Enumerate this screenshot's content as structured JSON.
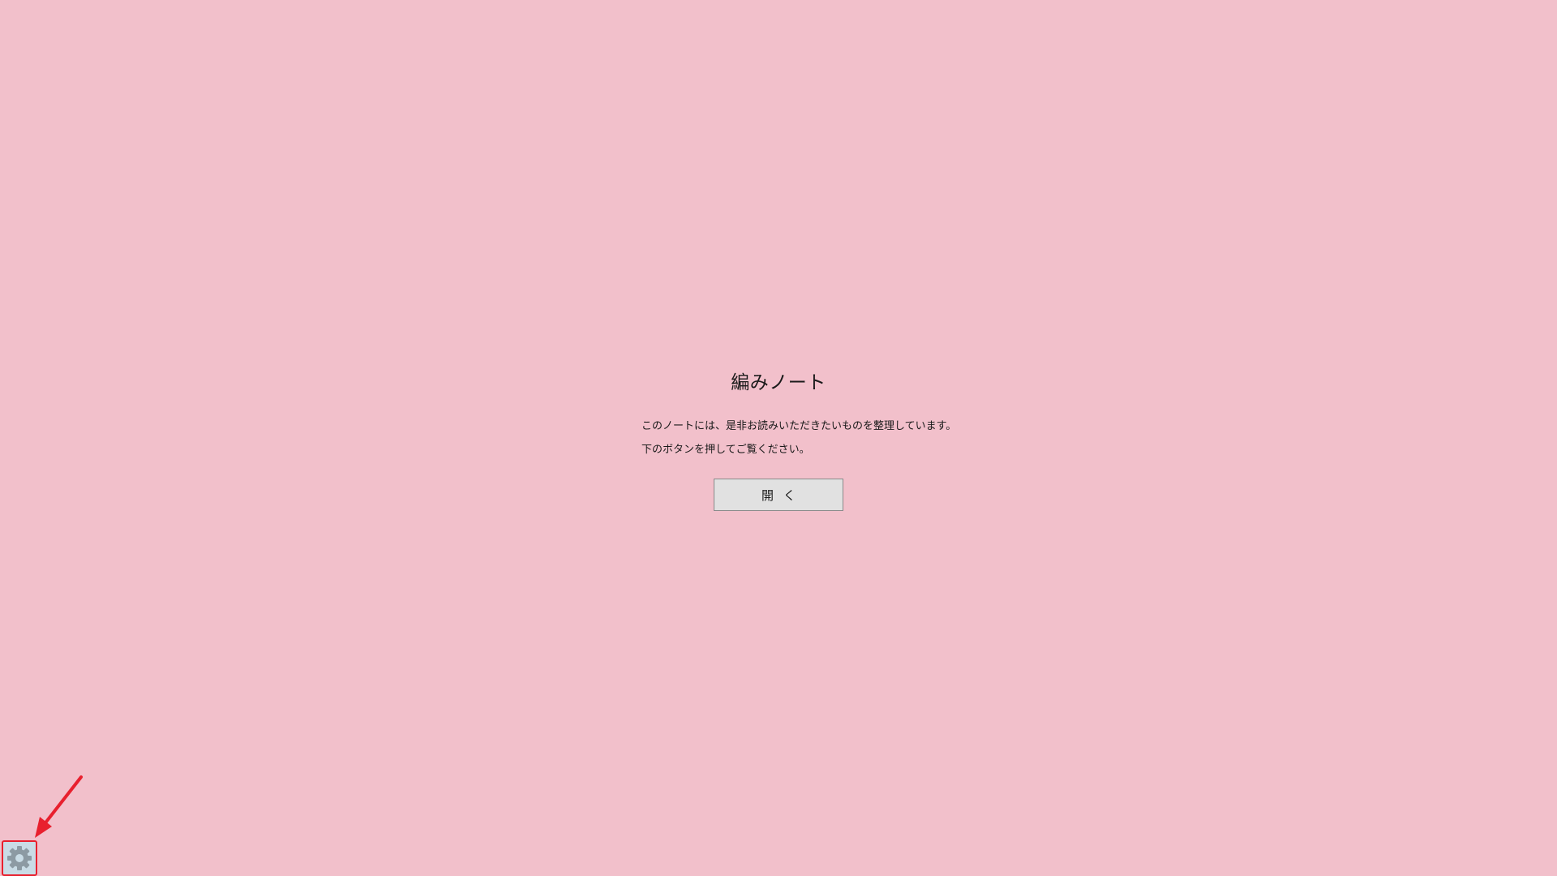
{
  "main": {
    "title": "編みノート",
    "description_lines": [
      "このノートには、是非お読みいただきたいものを整理しています。",
      "下のボタンを押してご覧ください。"
    ],
    "open_button_label": "開く"
  },
  "settings": {
    "icon": "gear-icon",
    "highlight_color": "#e8202e"
  },
  "colors": {
    "background": "#f2c0cb",
    "button_background": "#e1e1e1",
    "annotation": "#e8202e"
  }
}
